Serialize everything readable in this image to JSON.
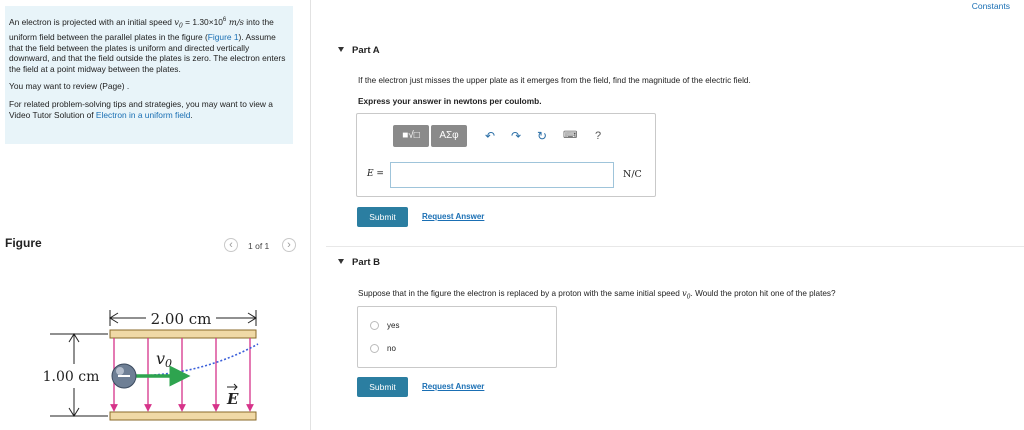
{
  "intro": {
    "problem_pre": "An electron is projected with an initial speed ",
    "speed_symbol": "v",
    "speed_sub": "0",
    "speed_eq": " = 1.30×10",
    "speed_exp": "6",
    "speed_unit": " m/s",
    "problem_mid": " into the uniform field between the parallel plates in the figure (",
    "figure_link": "Figure 1",
    "problem_post": "). Assume that the field between the plates is uniform and directed vertically downward, and that the field outside the plates is zero. The electron enters the field at a point midway between the plates.",
    "review_text": "You may want to review (Page) .",
    "tips_pre": "For related problem-solving tips and strategies, you may want to view a Video Tutor Solution of ",
    "tips_link": "Electron in a uniform field",
    "tips_post": "."
  },
  "figure": {
    "heading": "Figure",
    "pager_text": "1 of 1",
    "prev_icon": "chevron-left-icon",
    "next_icon": "chevron-right-icon",
    "width_label": "2.00 cm",
    "height_label": "1.00 cm",
    "velocity_label": "v",
    "velocity_sub": "0",
    "field_label": "E",
    "colors": {
      "plate": "#f0d9a6",
      "plate_border": "#8a6a2a",
      "field": "#d6338a",
      "velocity": "#2ea44f",
      "path": "#3a5fd9",
      "electron": "#6e7f95"
    }
  },
  "header": {
    "constants_link": "Constants"
  },
  "partA": {
    "title": "Part A",
    "question": "If the electron just misses the upper plate as it emerges from the field, find the magnitude of the electric field.",
    "instruction": "Express your answer in newtons per coulomb.",
    "toolbar": {
      "templates_icon": "templates-icon",
      "greek_label": "ΑΣφ",
      "undo_icon": "undo-icon",
      "redo_icon": "redo-icon",
      "reset_icon": "reset-icon",
      "keyboard_icon": "keyboard-icon",
      "help_label": "?"
    },
    "field_label": "E =",
    "field_value": "",
    "unit": "N/C",
    "submit_label": "Submit",
    "request_label": "Request Answer"
  },
  "partB": {
    "title": "Part B",
    "question_pre": "Suppose that in the figure the electron is replaced by a proton with the same initial speed ",
    "question_sym": "v",
    "question_sub": "0",
    "question_post": ". Would the proton hit one of the plates?",
    "options": [
      "yes",
      "no"
    ],
    "submit_label": "Submit",
    "request_label": "Request Answer"
  }
}
